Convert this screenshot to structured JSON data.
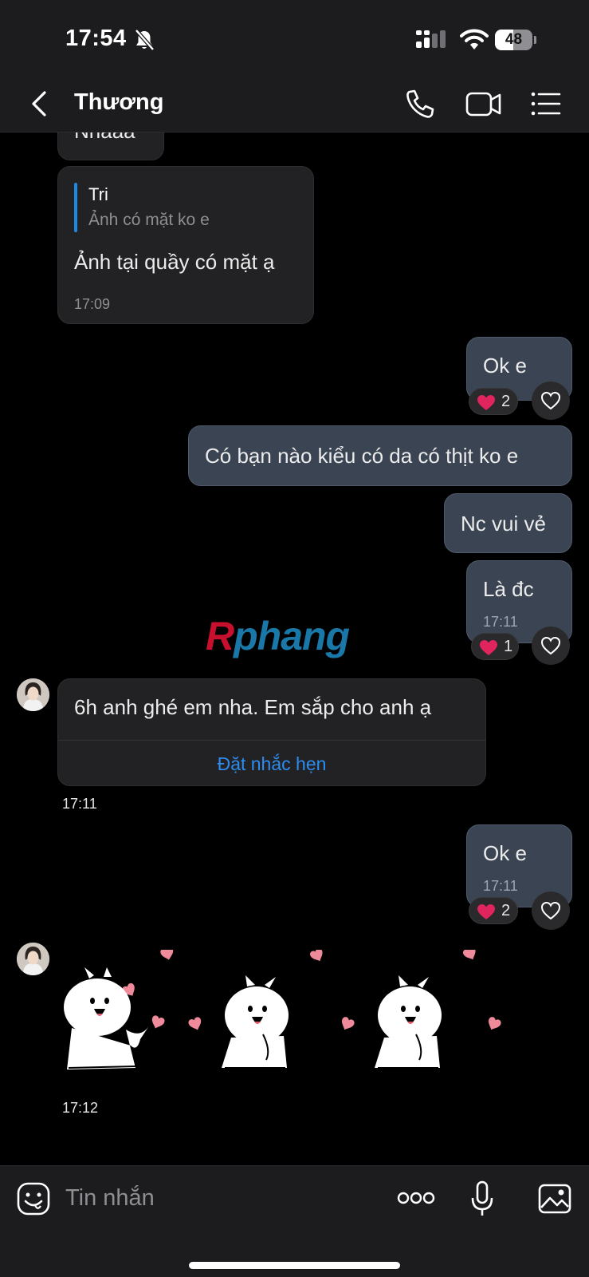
{
  "status_bar": {
    "time": "17:54",
    "battery": "48",
    "battery_level": 0.48
  },
  "header": {
    "contact_name": "Thương"
  },
  "messages": {
    "partial_text": "Nhaaa",
    "reply_msg": {
      "quoted_name": "Tri",
      "quoted_text": "Ảnh có mặt ko e",
      "text": "Ảnh tại quầy có mặt ạ",
      "time": "17:09"
    },
    "ok1": {
      "text": "Ok e",
      "reaction_count": "2"
    },
    "co_ban": {
      "text": "Có bạn nào kiểu có da có thịt ko e"
    },
    "nc_vui": {
      "text": "Nc vui vẻ"
    },
    "la_dc": {
      "text": "Là đc",
      "time": "17:11",
      "reaction_count": "1"
    },
    "reminder_msg": {
      "text": "6h anh ghé em nha. Em sắp cho anh ạ",
      "link": "Đặt nhắc hẹn",
      "time": "17:11"
    },
    "ok2": {
      "text": "Ok e",
      "time": "17:11",
      "reaction_count": "2"
    },
    "sticker": {
      "time": "17:12"
    }
  },
  "watermark": {
    "first_letter": "R",
    "rest": "phang"
  },
  "input": {
    "placeholder": "Tin nhắn"
  },
  "colors": {
    "accent": "#2d8cf0",
    "outgoing_bubble": "#3b4452",
    "incoming_bubble": "#222224",
    "heart": "#e0245e",
    "sticker_heart": "#ef8a9a"
  },
  "icons": [
    "bell-slash-icon",
    "signal-icon",
    "wifi-icon",
    "battery-icon",
    "back-chevron-icon",
    "phone-icon",
    "video-icon",
    "menu-list-icon",
    "heart-icon",
    "like-outline-icon",
    "emoji-icon",
    "more-icon",
    "mic-icon",
    "image-icon"
  ]
}
